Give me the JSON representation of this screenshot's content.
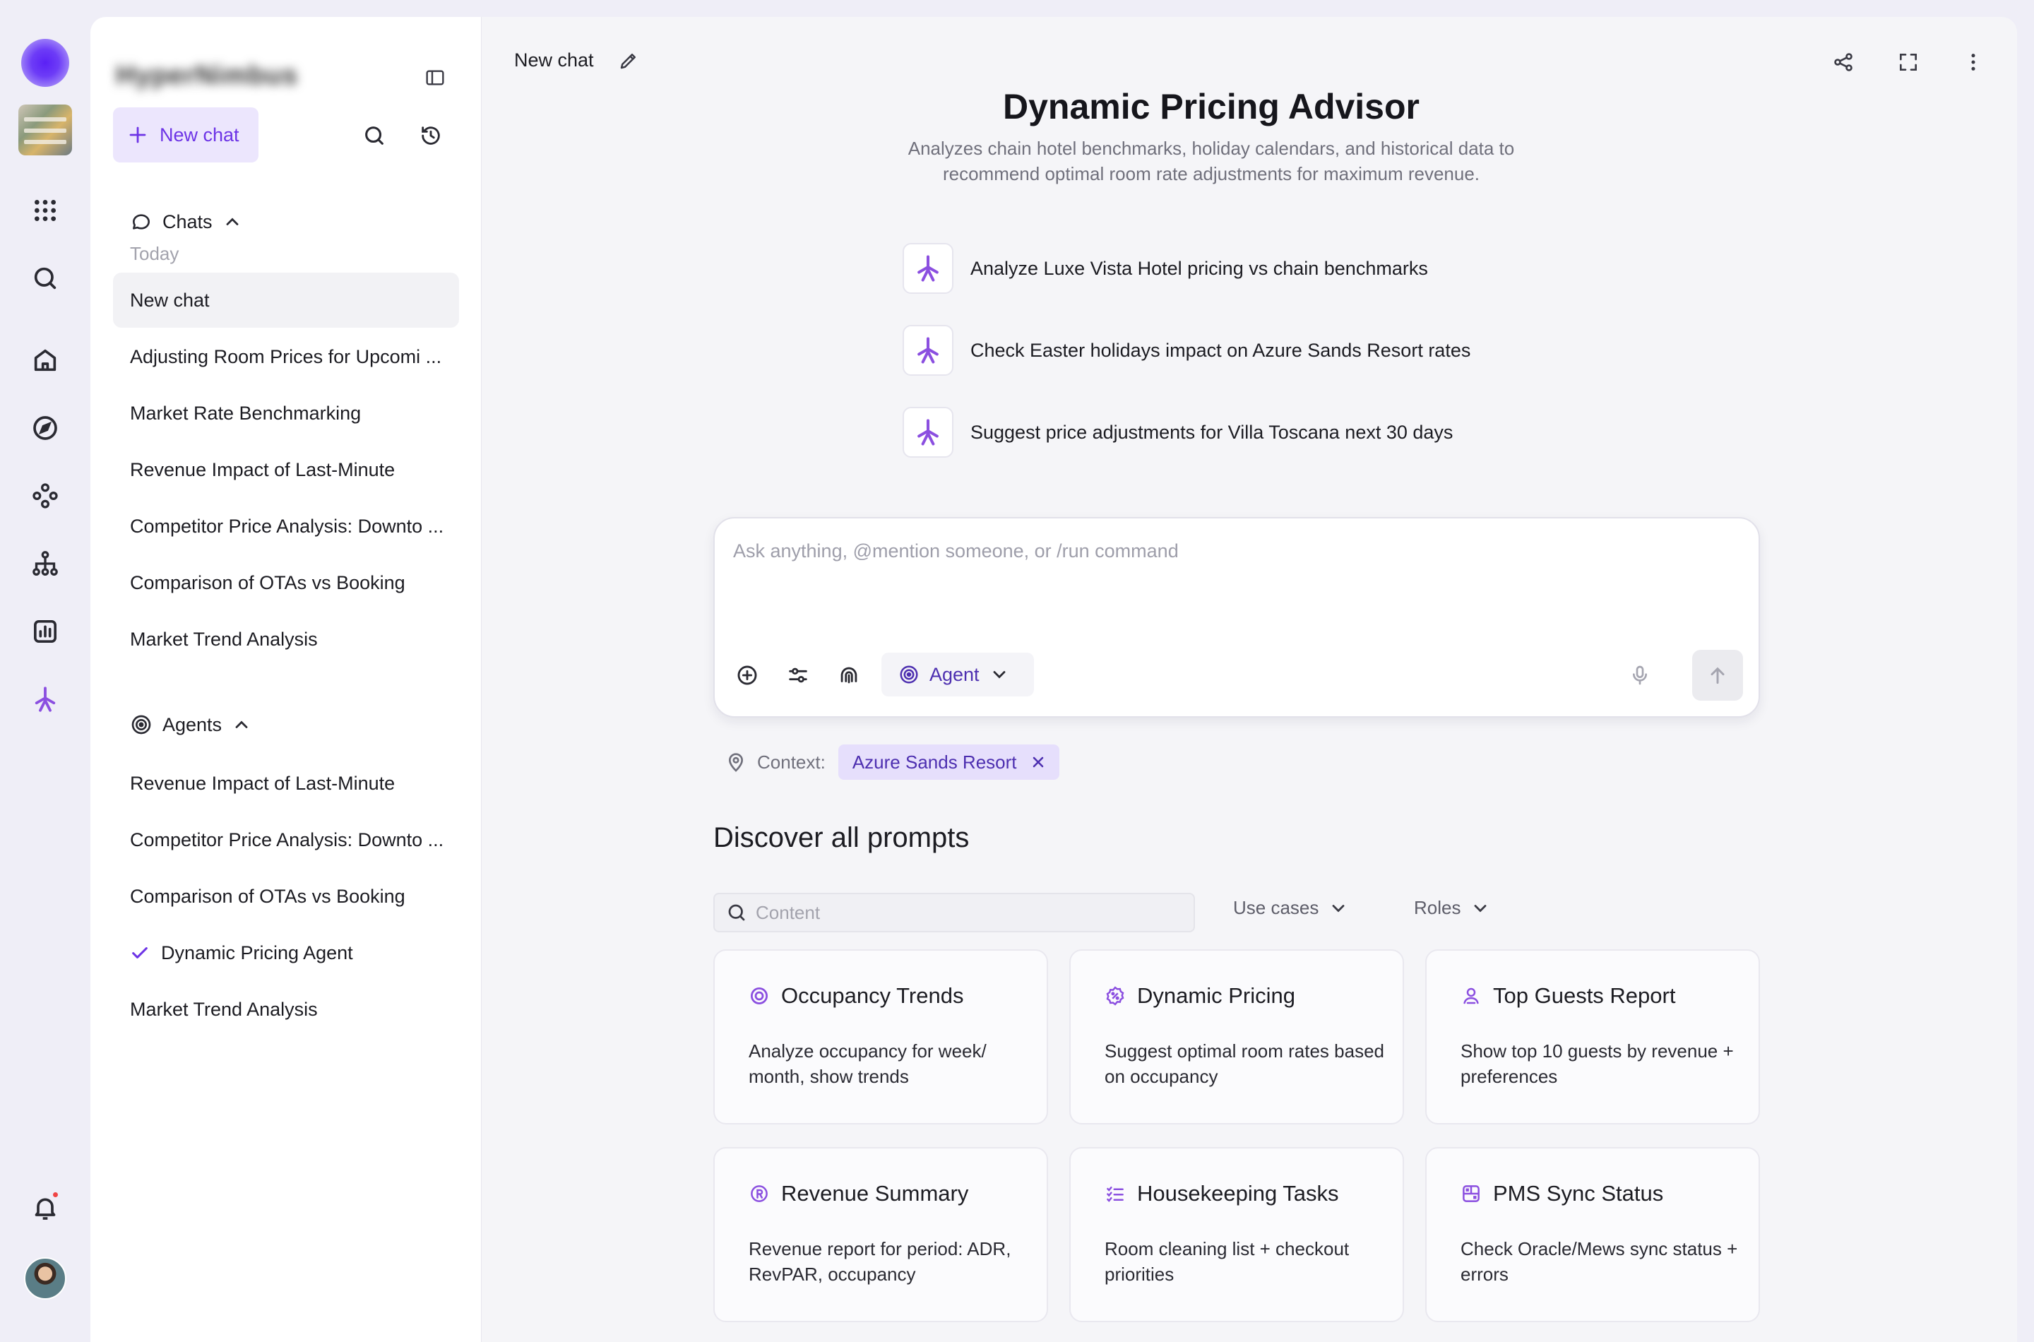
{
  "rail": {
    "icons": [
      "apps-grid-icon",
      "search-icon",
      "home-icon",
      "compass-icon",
      "integrations-icon",
      "hierarchy-icon",
      "analytics-icon",
      "agent-spark-icon"
    ],
    "accent": "#7c3aed"
  },
  "sidebar": {
    "brand": "HyperNimbus",
    "new_chat_label": "New chat",
    "chats_header": "Chats",
    "today_label": "Today",
    "chats": [
      "New chat",
      "Adjusting Room Prices for Upcomi ...",
      "Market Rate Benchmarking",
      "Revenue Impact of Last-Minute",
      "Competitor Price Analysis: Downto ...",
      "Comparison of OTAs vs Booking",
      "Market Trend Analysis"
    ],
    "agents_header": "Agents",
    "agents": [
      "Revenue Impact of Last-Minute",
      "Competitor Price Analysis: Downto ...",
      "Comparison of OTAs vs Booking",
      "Dynamic Pricing Agent",
      "Market Trend Analysis"
    ]
  },
  "main": {
    "chat_title": "New chat",
    "hero_title": "Dynamic Pricing Advisor",
    "hero_subtitle": "Analyzes chain hotel benchmarks, holiday calendars, and historical data to recommend optimal room rate adjustments for maximum revenue.",
    "suggestions": [
      "Analyze Luxe Vista Hotel pricing vs chain benchmarks",
      "Check Easter holidays impact on Azure Sands Resort rates",
      "Suggest price adjustments for Villa Toscana next 30 days"
    ],
    "composer": {
      "placeholder": "Ask anything, @mention someone, or /run command",
      "value": "",
      "agent_label": "Agent"
    },
    "context_label": "Context:",
    "context_chip": "Azure Sands Resort",
    "discover_title": "Discover all prompts",
    "prompt_search_placeholder": "Content",
    "filters": {
      "use_cases": "Use cases",
      "roles": "Roles"
    },
    "cards": [
      {
        "title": "Occupancy Trends",
        "desc": "Analyze occupancy for week/ month, show trends",
        "icon": "target-ring-icon"
      },
      {
        "title": "Dynamic Pricing",
        "desc": "Suggest optimal room rates based on occupancy",
        "icon": "price-badge-icon"
      },
      {
        "title": "Top Guests Report",
        "desc": "Show top 10 guests by revenue + preferences",
        "icon": "guest-icon"
      },
      {
        "title": "Revenue Summary",
        "desc": "Revenue report for period: ADR, RevPAR, occupancy",
        "icon": "revenue-r-icon"
      },
      {
        "title": "Housekeeping Tasks",
        "desc": "Room cleaning list + checkout priorities",
        "icon": "checklist-icon"
      },
      {
        "title": "PMS Sync Status",
        "desc": "Check Oracle/Mews sync status + errors",
        "icon": "sync-grid-icon"
      }
    ]
  }
}
